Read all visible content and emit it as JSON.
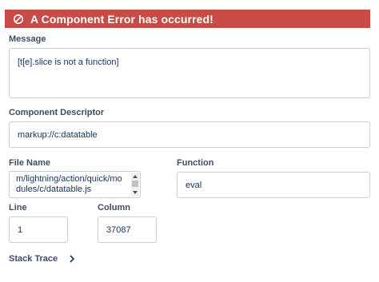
{
  "error": {
    "title": "A Component Error has occurred!",
    "icon": "ban-icon"
  },
  "message": {
    "label": "Message",
    "value": "[t[e].slice is not a function]"
  },
  "descriptor": {
    "label": "Component Descriptor",
    "value": "markup://c:datatable"
  },
  "file": {
    "label": "File Name",
    "value": "m/lightning/action/quick/modules/c/datatable.js"
  },
  "function": {
    "label": "Function",
    "value": "eval"
  },
  "line": {
    "label": "Line",
    "value": "1"
  },
  "column": {
    "label": "Column",
    "value": "37087"
  },
  "stack": {
    "label": "Stack Trace",
    "icon": "chevron-right-icon"
  },
  "colors": {
    "header_bg": "#c84b47",
    "label_text": "#3e4b6b",
    "field_border": "#c9ced6"
  }
}
